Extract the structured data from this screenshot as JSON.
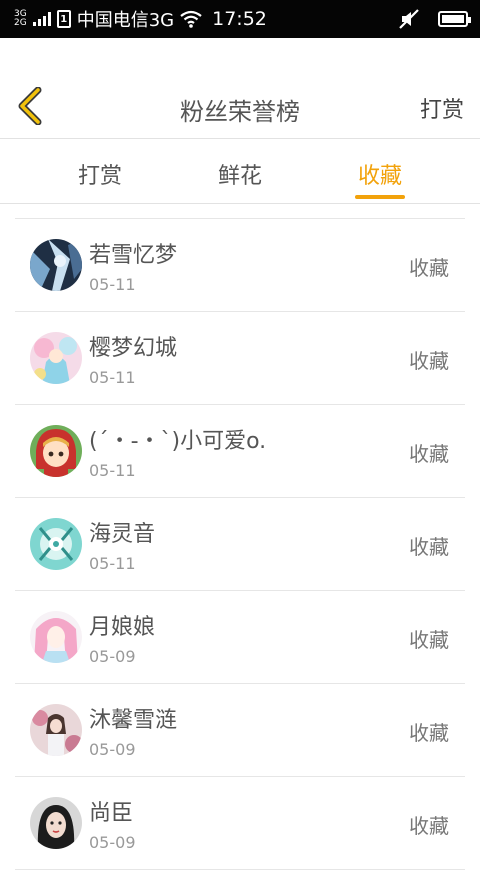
{
  "status_bar": {
    "network_top": "3G",
    "network_bottom": "2G",
    "sim_label": "1",
    "carrier": "中国电信3G",
    "time": "17:52"
  },
  "header": {
    "title": "粉丝荣誉榜",
    "right_action": "打赏",
    "accent_color": "#f2a20b"
  },
  "tabs": [
    {
      "label": "打赏",
      "active": false
    },
    {
      "label": "鲜花",
      "active": false
    },
    {
      "label": "收藏",
      "active": true
    }
  ],
  "fans": [
    {
      "name": "若雪忆梦",
      "date": "05-11",
      "action": "收藏"
    },
    {
      "name": "樱梦幻城",
      "date": "05-11",
      "action": "收藏"
    },
    {
      "name": "(´・-・`)小可爱o.",
      "date": "05-11",
      "action": "收藏"
    },
    {
      "name": "海灵音",
      "date": "05-11",
      "action": "收藏"
    },
    {
      "name": "月娘娘",
      "date": "05-09",
      "action": "收藏"
    },
    {
      "name": "沐馨雪涟",
      "date": "05-09",
      "action": "收藏"
    },
    {
      "name": "尚臣",
      "date": "05-09",
      "action": "收藏"
    }
  ]
}
